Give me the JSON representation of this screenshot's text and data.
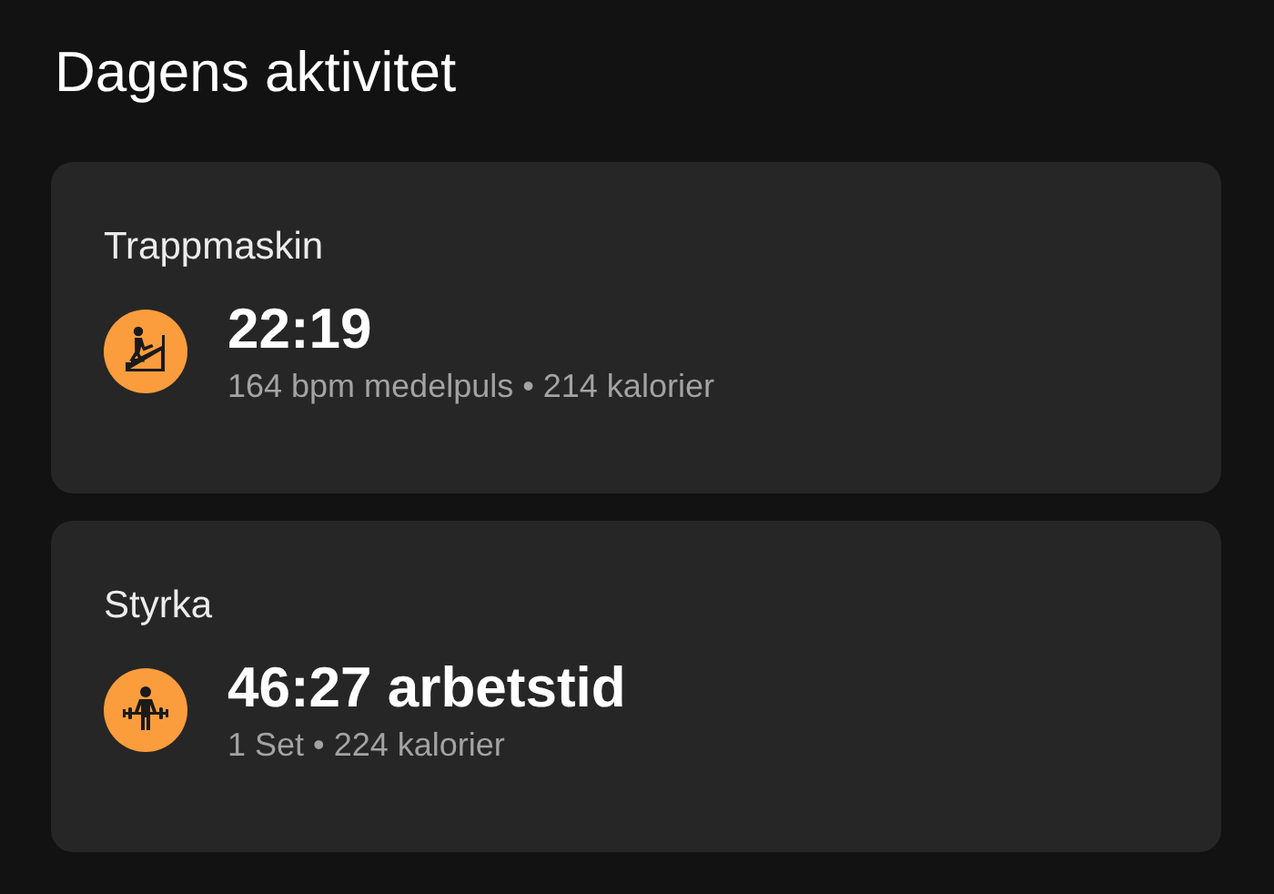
{
  "title": "Dagens aktivitet",
  "activities": [
    {
      "kind": "stairs",
      "name": "Trappmaskin",
      "headline": "22:19",
      "details": "164 bpm medelpuls • 214 kalorier"
    },
    {
      "kind": "weights",
      "name": "Styrka",
      "headline": "46:27 arbetstid",
      "details": "1 Set • 224 kalorier"
    }
  ]
}
